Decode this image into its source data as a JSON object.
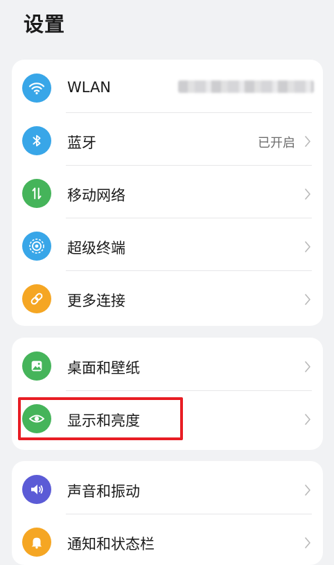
{
  "header": {
    "title": "设置"
  },
  "groups": [
    {
      "items": [
        {
          "label": "WLAN",
          "value": "",
          "icon": "wifi-icon",
          "color": "#38a6e8"
        },
        {
          "label": "蓝牙",
          "value": "已开启",
          "icon": "bluetooth-icon",
          "color": "#38a6e8"
        },
        {
          "label": "移动网络",
          "value": "",
          "icon": "mobile-data-icon",
          "color": "#45b45a"
        },
        {
          "label": "超级终端",
          "value": "",
          "icon": "super-device-icon",
          "color": "#38a6e8"
        },
        {
          "label": "更多连接",
          "value": "",
          "icon": "link-icon",
          "color": "#f5a623"
        }
      ]
    },
    {
      "items": [
        {
          "label": "桌面和壁纸",
          "value": "",
          "icon": "wallpaper-icon",
          "color": "#45b45a"
        },
        {
          "label": "显示和亮度",
          "value": "",
          "icon": "eye-icon",
          "color": "#45b45a"
        }
      ]
    },
    {
      "items": [
        {
          "label": "声音和振动",
          "value": "",
          "icon": "sound-icon",
          "color": "#5b5bd6"
        },
        {
          "label": "通知和状态栏",
          "value": "",
          "icon": "bell-icon",
          "color": "#f5a623"
        }
      ]
    }
  ],
  "highlight": {
    "color": "#e81d24",
    "target": "显示和亮度"
  }
}
